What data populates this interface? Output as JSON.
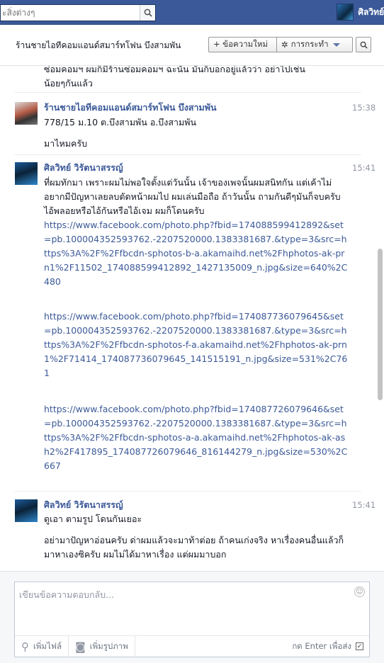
{
  "topbar": {
    "search_placeholder": "ะสิ่งต่างๆ",
    "profile_name": "ศิลวิทย์"
  },
  "header": {
    "title": "ร้านชายไอทีคอมแอนด์สมาร์ทโฟน บึงสามพัน",
    "new_message_label": "+ ข้อความใหม่",
    "actions_label": "การกระทำ"
  },
  "messages": {
    "partial_top": "ซ่อมคอมฯ ผมก็มีร้านซ่อมคอมฯ ฉะนั้น มันก็บอกอยู่แล้วว่า อย่าไปเช่น\nน้อยๆกันแล้ว",
    "groups": [
      {
        "sender": "ร้านชายไอทีคอมแอนด์สมาร์ทโฟน บึงสามพัน",
        "time": "15:38",
        "lines": [
          "778/15 ม.10 ต.บึงสามพัน อ.บึงสามพัน",
          "มาไหมครับ"
        ]
      },
      {
        "sender": "ศิลวิทย์ วิรัตนาสรรญ์",
        "time": "15:41",
        "text": "ที่ผมทักมา เพราะผมไม่พอใจตั้งแต่วันนั้น เจ้าของเพจนั้นผมสนิทกัน แต่เค้าไม่อยากมีปัญหาเลยลบตัดหน้าผมไป ผมเล่นมือถือ ถ้าวันนั้น ถามกันดีๆมันก็จบครับ ไอ้พลอยหรือไอ้กันหรือไอ้เจม ผมก็โดนครับ",
        "links": [
          "https://www.facebook.com/photo.php?fbid=174088599412892&set=pb.100004352593762.-2207520000.1383381687.&type=3&src=https%3A%2F%2Ffbcdn-sphotos-b-a.akamaihd.net%2Fhphotos-ak-prn1%2F11502_174088599412892_1427135009_n.jpg&size=640%2C480",
          "https://www.facebook.com/photo.php?fbid=174087736079645&set=pb.100004352593762.-2207520000.1383381687.&type=3&src=https%3A%2F%2Ffbcdn-sphotos-f-a.akamaihd.net%2Fhphotos-ak-prn1%2F71414_174087736079645_141515191_n.jpg&size=531%2C761",
          "https://www.facebook.com/photo.php?fbid=174087726079646&set=pb.100004352593762.-2207520000.1383381687.&type=3&src=https%3A%2F%2Ffbcdn-sphotos-a-a.akamaihd.net%2Fhphotos-ak-ash2%2F417895_174087726079646_816144279_n.jpg&size=530%2C667"
        ]
      },
      {
        "sender": "ศิลวิทย์ วิรัตนาสรรญ์",
        "time": "15:41",
        "lines": [
          "ดูเอา ตามรูป โดนกันเยอะ",
          "อย่ามาปัญหาอ่อนครับ ด่าผมแล้วจะมาท้าต่อย ถ้าคนเก่งจริง หาเรื่องคนอื่นแล้วก็มาหาเองซิครับ ผมไม่ได้มาหาเรื่อง แต่ผมมาบอก"
        ]
      }
    ]
  },
  "composer": {
    "placeholder": "เขียนข้อความตอบกลับ...",
    "attach_file_label": "เพิ่มไฟล์",
    "add_photo_label": "เพิ่มรูปภาพ",
    "enter_to_send_label": "กด Enter เพื่อส่ง",
    "enter_to_send_checked": true
  }
}
